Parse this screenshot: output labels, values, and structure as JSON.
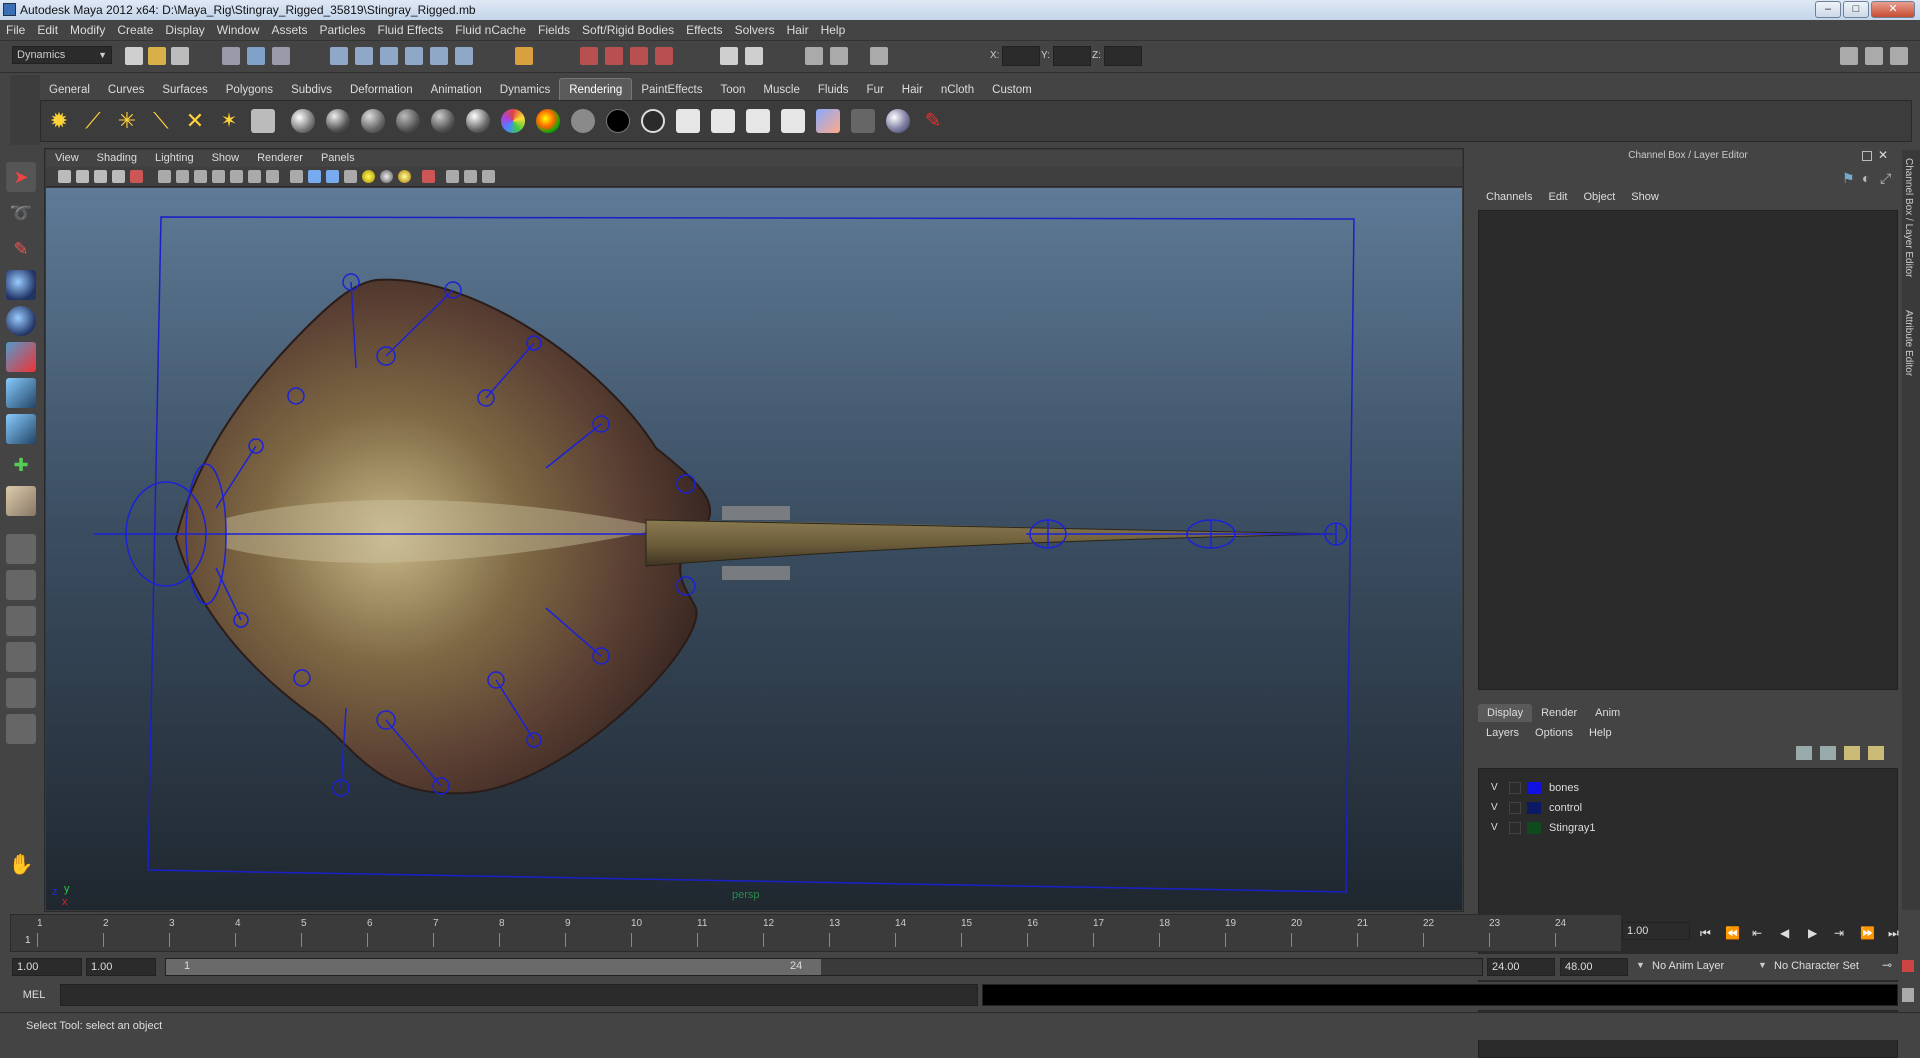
{
  "window": {
    "title": "Autodesk Maya 2012 x64: D:\\Maya_Rig\\Stingray_Rigged_35819\\Stingray_Rigged.mb"
  },
  "menu": [
    "File",
    "Edit",
    "Modify",
    "Create",
    "Display",
    "Window",
    "Assets",
    "Particles",
    "Fluid Effects",
    "Fluid nCache",
    "Fields",
    "Soft/Rigid Bodies",
    "Effects",
    "Solvers",
    "Hair",
    "Help"
  ],
  "status": {
    "menuset": "Dynamics",
    "x_label": "X:",
    "y_label": "Y:",
    "z_label": "Z:"
  },
  "shelf_tabs": [
    "General",
    "Curves",
    "Surfaces",
    "Polygons",
    "Subdivs",
    "Deformation",
    "Animation",
    "Dynamics",
    "Rendering",
    "PaintEffects",
    "Toon",
    "Muscle",
    "Fluids",
    "Fur",
    "Hair",
    "nCloth",
    "Custom"
  ],
  "shelf_active": "Rendering",
  "panel_menu": [
    "View",
    "Shading",
    "Lighting",
    "Show",
    "Renderer",
    "Panels"
  ],
  "viewport": {
    "camera": "persp",
    "axis_y": "y",
    "axis_x": "x"
  },
  "channel_box": {
    "title": "Channel Box / Layer Editor",
    "menu": [
      "Channels",
      "Edit",
      "Object",
      "Show"
    ]
  },
  "layer_editor": {
    "tabs": [
      "Display",
      "Render",
      "Anim"
    ],
    "active_tab": "Display",
    "menu": [
      "Layers",
      "Options",
      "Help"
    ],
    "layers": [
      {
        "visible": "V",
        "name": "bones",
        "color": "#1010e0"
      },
      {
        "visible": "V",
        "name": "control",
        "color": "#0a1a66"
      },
      {
        "visible": "V",
        "name": "Stingray1",
        "color": "#0e4a1e"
      }
    ]
  },
  "side_tabs": [
    "Channel Box / Layer Editor",
    "Attribute Editor"
  ],
  "timeline": {
    "ticks": [
      "1",
      "2",
      "3",
      "4",
      "5",
      "6",
      "7",
      "8",
      "9",
      "10",
      "11",
      "12",
      "13",
      "14",
      "15",
      "16",
      "17",
      "18",
      "19",
      "20",
      "21",
      "22",
      "23",
      "24"
    ],
    "current_marker": "1",
    "current_frame": "1.00"
  },
  "range": {
    "start": "1.00",
    "anim_start": "1.00",
    "slider_start": "1",
    "slider_end": "24",
    "end": "24.00",
    "anim_end": "48.00",
    "anim_layer": "No Anim Layer",
    "char_set": "No Character Set"
  },
  "command": {
    "label": "MEL"
  },
  "help": {
    "text": "Select Tool: select an object"
  }
}
